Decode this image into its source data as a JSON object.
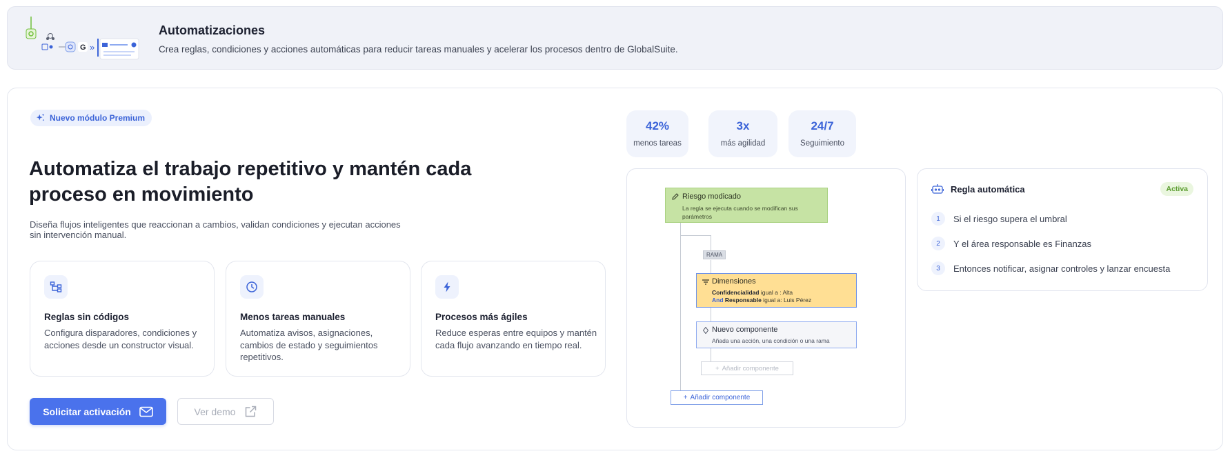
{
  "header": {
    "title": "Automatizaciones",
    "description": "Crea reglas, condiciones y acciones automáticas para reducir tareas manuales y acelerar los procesos dentro de GlobalSuite."
  },
  "hero": {
    "badge": "Nuevo módulo Premium",
    "title": "Automatiza el trabajo repetitivo y mantén cada proceso en movimiento",
    "subtitle": "Diseña flujos inteligentes que reaccionan a cambios, validan condiciones y ejecutan acciones sin intervención manual."
  },
  "features": [
    {
      "icon": "flow-icon",
      "title": "Reglas sin códigos",
      "text": "Configura disparadores, condiciones y acciones desde un constructor visual."
    },
    {
      "icon": "clock-icon",
      "title": "Menos tareas manuales",
      "text": "Automatiza avisos, asignaciones, cambios de estado y seguimientos repetitivos."
    },
    {
      "icon": "bolt-icon",
      "title": "Procesos más ágiles",
      "text": "Reduce esperas entre equipos y mantén cada flujo avanzando en tiempo real."
    }
  ],
  "buttons": {
    "primary": "Solicitar activación",
    "secondary": "Ver demo"
  },
  "stats": [
    {
      "value": "42%",
      "label": "menos tareas"
    },
    {
      "value": "3x",
      "label": "más agilidad"
    },
    {
      "value": "24/7",
      "label": "Seguimiento"
    }
  ],
  "flow": {
    "trigger": {
      "title": "Riesgo modicado",
      "text": "La regla se ejecuta cuando se modifican sus parámetros"
    },
    "branch": "RAMA",
    "dimensions": {
      "title": "Dimensiones",
      "row1_field": "Confidencialidad",
      "row1_rest": " igual a : Alta",
      "row2_kw": "And",
      "row2_field": "Responsable",
      "row2_rest": " igual a: Luis Pérez"
    },
    "new_component": {
      "title": "Nuevo componente",
      "text": "Añada una acción, una condición o una rama"
    },
    "add_inner": "Añadir componente",
    "add_outer": "Añadir componente"
  },
  "rule": {
    "title": "Regla automática",
    "status": "Activa",
    "steps": [
      {
        "num": "1",
        "text": "Si el riesgo supera el umbral"
      },
      {
        "num": "2",
        "text": "Y el área responsable es Finanzas"
      },
      {
        "num": "3",
        "text": "Entonces notificar, asignar controles y lanzar encuesta"
      }
    ]
  },
  "colors": {
    "accent": "#4a72ec",
    "trigger_bg": "#c6e3a4",
    "dimensions_bg": "#ffdf94",
    "active_badge": "#5a9c2e"
  }
}
